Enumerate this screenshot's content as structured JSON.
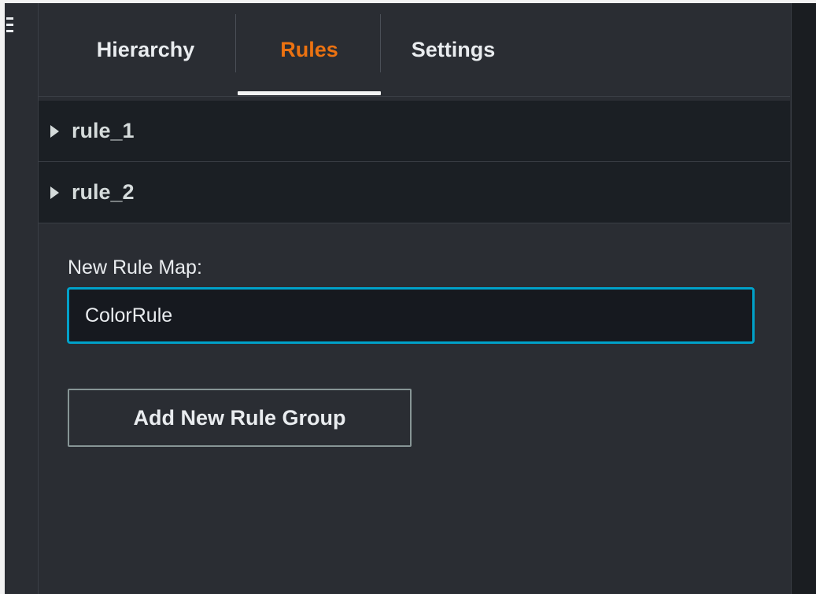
{
  "tabs": {
    "hierarchy": "Hierarchy",
    "rules": "Rules",
    "settings": "Settings"
  },
  "rules": {
    "items": [
      {
        "label": "rule_1"
      },
      {
        "label": "rule_2"
      }
    ]
  },
  "form": {
    "new_rule_map_label": "New Rule Map:",
    "new_rule_map_value": "ColorRule",
    "add_button_label": "Add New Rule Group"
  },
  "colors": {
    "active_tab": "#ec7211",
    "input_focus": "#00a1c9",
    "panel_bg": "#2a2d33"
  }
}
